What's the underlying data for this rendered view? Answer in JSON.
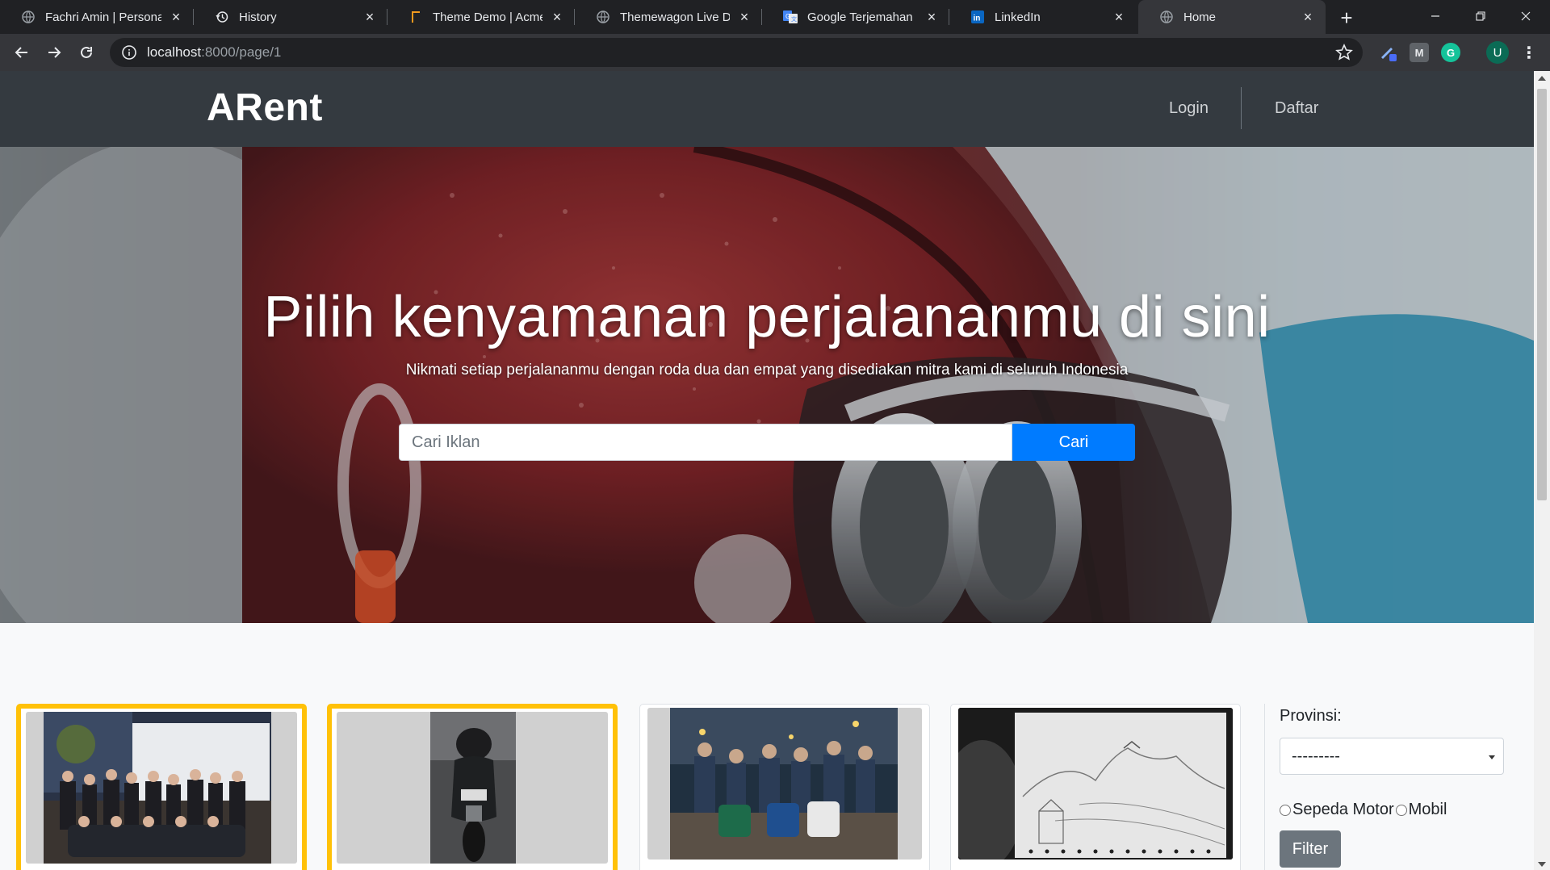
{
  "browser": {
    "tabs": [
      {
        "title": "Fachri Amin | Personal Portfolio",
        "icon": "globe-icon",
        "active": false
      },
      {
        "title": "History",
        "icon": "history-icon",
        "active": false
      },
      {
        "title": "Theme Demo | Acme Themes",
        "icon": "acme-icon",
        "active": false
      },
      {
        "title": "Themewagon Live Demo",
        "icon": "globe-icon",
        "active": false
      },
      {
        "title": "Google Terjemahan",
        "icon": "google-translate-icon",
        "active": false
      },
      {
        "title": "LinkedIn",
        "icon": "linkedin-icon",
        "active": false
      },
      {
        "title": "Home",
        "icon": "globe-icon",
        "active": true
      }
    ],
    "url_host": "localhost",
    "url_rest": ":8000/page/1",
    "profile_initial": "U",
    "ext_m": "M",
    "ext_g": "G"
  },
  "site": {
    "brand": "ARent",
    "nav": {
      "login": "Login",
      "register": "Daftar"
    }
  },
  "hero": {
    "title": "Pilih kenyamanan perjalananmu di sini",
    "subtitle": "Nikmati setiap perjalananmu dengan roda dua dan empat yang disediakan mitra kami di seluruh Indonesia",
    "search_placeholder": "Cari Iklan",
    "search_button": "Cari"
  },
  "filter": {
    "province_label": "Provinsi:",
    "province_selected": "---------",
    "vehicle_options": [
      "Sepeda Motor",
      "Mobil"
    ],
    "filter_button": "Filter"
  },
  "colors": {
    "featured_border": "#ffc107",
    "primary": "#007bff",
    "navbar": "#343a40",
    "secondary": "#6c757d"
  }
}
